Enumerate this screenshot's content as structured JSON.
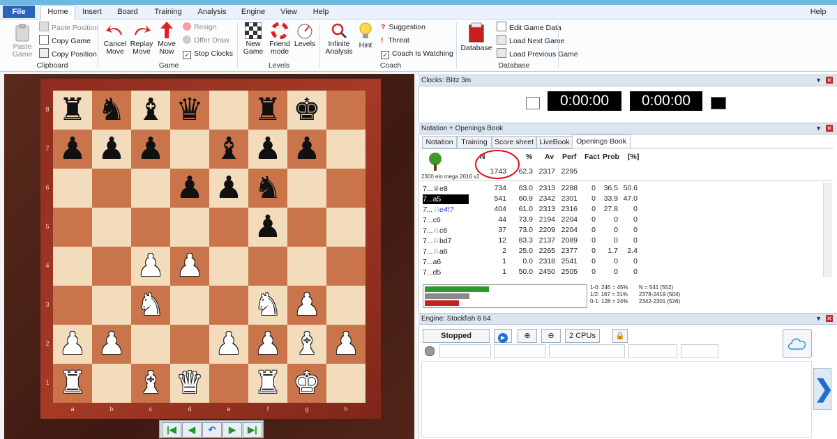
{
  "menu": {
    "file": "File",
    "items": [
      "Home",
      "Insert",
      "Board",
      "Training",
      "Analysis",
      "Engine",
      "View",
      "Help"
    ],
    "help_right": "Help"
  },
  "ribbon": {
    "clipboard": {
      "paste_game": "Paste Game",
      "paste_position": "Paste Position",
      "copy_game": "Copy Game",
      "copy_position": "Copy Position",
      "group": "Clipboard"
    },
    "game": {
      "cancel_move": "Cancel Move",
      "replay_move": "Replay Move",
      "move_now": "Move Now",
      "resign": "Resign",
      "offer_draw": "Offer Draw",
      "stop_clocks": "Stop Clocks",
      "group": "Game"
    },
    "levels": {
      "new_game": "New Game",
      "friend_mode": "Friend mode",
      "levels": "Levels",
      "group": "Levels"
    },
    "coach": {
      "infinite_analysis": "Infinite Analysis",
      "hint": "Hint",
      "suggestion": "Suggestion",
      "threat": "Threat",
      "coach_watching": "Coach Is Watching",
      "group": "Coach"
    },
    "database": {
      "database": "Database",
      "edit_game_data": "Edit Game Data",
      "load_next_game": "Load Next Game",
      "load_previous_game": "Load Previous Game",
      "group": "Database"
    }
  },
  "board": {
    "ranks": [
      "8",
      "7",
      "6",
      "5",
      "4",
      "3",
      "2",
      "1"
    ],
    "files": [
      "a",
      "b",
      "c",
      "d",
      "e",
      "f",
      "g",
      "h"
    ],
    "fen_rows": [
      "rnbq1rk1",
      "ppp1bpp1",
      "...ppn..",
      ".....p..",
      "..PP....",
      "..N..NP.",
      "PP..PPBP",
      "R.BQ.RK."
    ]
  },
  "clocks": {
    "title": "Clocks: Blitz 3m",
    "white": "0:00:00",
    "black": "0:00:00"
  },
  "notation": {
    "title": "Notation + Openings Book",
    "tabs": [
      "Notation",
      "Training",
      "Score sheet",
      "LiveBook",
      "Openings Book"
    ],
    "headers": [
      "N",
      "%",
      "Av",
      "Perf",
      "Fact",
      "Prob",
      "[%]"
    ],
    "book_name": "2300 elo mega 2016 v2",
    "total": {
      "n": "1743",
      "pct": "62.3",
      "av": "2317",
      "perf": "2295"
    },
    "moves": [
      {
        "move": "7...♕e8",
        "n": "734",
        "pct": "63.0",
        "av": "2313",
        "perf": "2288",
        "fact": "0",
        "prob": "36.5",
        "w": "50.6"
      },
      {
        "move": "7...a5",
        "n": "541",
        "pct": "60.9",
        "av": "2342",
        "perf": "2301",
        "fact": "0",
        "prob": "33.9",
        "w": "47.0"
      },
      {
        "move": "7...♘e4!?",
        "n": "404",
        "pct": "61.0",
        "av": "2313",
        "perf": "2316",
        "fact": "0",
        "prob": "27.8",
        "w": "0"
      },
      {
        "move": "7...c6",
        "n": "44",
        "pct": "73.9",
        "av": "2194",
        "perf": "2204",
        "fact": "0",
        "prob": "0",
        "w": "0"
      },
      {
        "move": "7...♘c6",
        "n": "37",
        "pct": "73.0",
        "av": "2209",
        "perf": "2204",
        "fact": "0",
        "prob": "0",
        "w": "0"
      },
      {
        "move": "7...♘bd7",
        "n": "12",
        "pct": "83.3",
        "av": "2137",
        "perf": "2089",
        "fact": "0",
        "prob": "0",
        "w": "0"
      },
      {
        "move": "7...♘a6",
        "n": "2",
        "pct": "25.0",
        "av": "2265",
        "perf": "2377",
        "fact": "0",
        "prob": "1.7",
        "w": "2.4"
      },
      {
        "move": "7...a6",
        "n": "1",
        "pct": "0.0",
        "av": "2318",
        "perf": "2541",
        "fact": "0",
        "prob": "0",
        "w": "0"
      },
      {
        "move": "7...d5",
        "n": "1",
        "pct": "50.0",
        "av": "2450",
        "perf": "2505",
        "fact": "0",
        "prob": "0",
        "w": "0"
      }
    ],
    "stats": {
      "win": "1-0: 246 = 45%",
      "draw": "1/2: 167 = 31%",
      "loss": "0-1: 128 = 24%",
      "n": "N = 541 (552)",
      "range1": "2378-2419 (504)",
      "range2": "2342-2301 (526)",
      "win_frac": 0.45,
      "draw_frac": 0.31,
      "loss_frac": 0.24
    }
  },
  "engine": {
    "title": "Engine: Stockfish 8 64",
    "status": "Stopped",
    "cpus": "2 CPUs"
  },
  "colors": {
    "accent": "#2b64b4",
    "win": "#2d9a2d",
    "draw": "#8a8a8a",
    "loss": "#c0241f",
    "highlight": "#e0101a"
  }
}
